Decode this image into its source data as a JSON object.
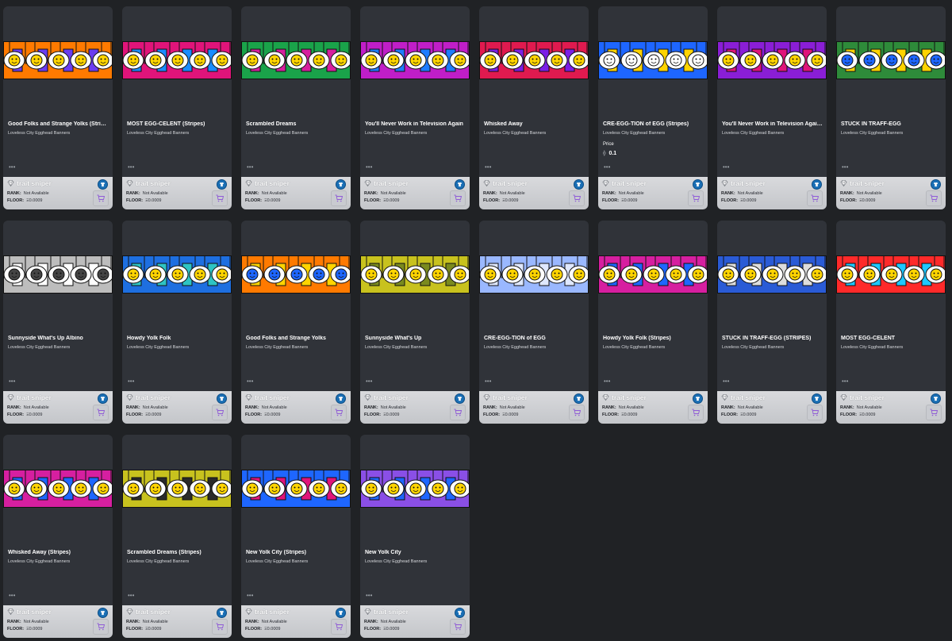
{
  "common": {
    "collection": "Loveless City Egghead Banners",
    "dots": "•••",
    "brand": "trait sniper",
    "rank_label": "RANK:",
    "rank_value": "Not Available",
    "floor_label": "FLOOR:",
    "floor_value": "Ξ0.0009",
    "price_label": "Price",
    "eth_symbol": "⟠"
  },
  "cards": [
    {
      "title": "Good Folks and Strange Yolks (Stripes)",
      "palette": [
        "#ff7a00",
        "#6a3df0",
        "#ffd400"
      ],
      "price": ""
    },
    {
      "title": "MOST EGG-CELENT (Stripes)",
      "palette": [
        "#e0147a",
        "#1a8cff",
        "#ffd400"
      ],
      "price": ""
    },
    {
      "title": "Scrambled Dreams",
      "palette": [
        "#1aa34a",
        "#d61f9e",
        "#ffd400"
      ],
      "price": ""
    },
    {
      "title": "You'll Never Work in Television Again",
      "palette": [
        "#c01ec8",
        "#1e7cff",
        "#ffd400"
      ],
      "price": ""
    },
    {
      "title": "Whisked Away",
      "palette": [
        "#e01a4f",
        "#7b1ee6",
        "#ffd400"
      ],
      "price": ""
    },
    {
      "title": "CRE-EGG-TION of EGG (Stripes)",
      "palette": [
        "#1e66ff",
        "#ffd400",
        "#ffffff"
      ],
      "price": "0.1"
    },
    {
      "title": "You'll Never Work in Television Again (...",
      "palette": [
        "#8a1ed6",
        "#e0147a",
        "#ffd400"
      ],
      "price": ""
    },
    {
      "title": "STUCK IN TRAFF-EGG",
      "palette": [
        "#2e8b3a",
        "#ffd400",
        "#1e66ff"
      ],
      "price": ""
    },
    {
      "title": "Sunnyside What's Up Albino",
      "palette": [
        "#bdbdbd",
        "#ffffff",
        "#444444"
      ],
      "price": ""
    },
    {
      "title": "Howdy Yolk Folk",
      "palette": [
        "#1e6fe0",
        "#2ec4c4",
        "#ffd400"
      ],
      "price": ""
    },
    {
      "title": "Good Folks and Strange Yolks",
      "palette": [
        "#ff7a00",
        "#ffd400",
        "#1e66ff"
      ],
      "price": ""
    },
    {
      "title": "Sunnyside What's Up",
      "palette": [
        "#c8c21e",
        "#7a8a1e",
        "#ffd400"
      ],
      "price": ""
    },
    {
      "title": "CRE-EGG-TION of EGG",
      "palette": [
        "#9ab8ff",
        "#dfe8ff",
        "#ffd400"
      ],
      "price": ""
    },
    {
      "title": "Howdy Yolk Folk (Stripes)",
      "palette": [
        "#d61fa0",
        "#1e66ff",
        "#ffd400"
      ],
      "price": ""
    },
    {
      "title": "STUCK IN TRAFF-EGG (STRIPES)",
      "palette": [
        "#2a5bd6",
        "#dddddd",
        "#ffd400"
      ],
      "price": ""
    },
    {
      "title": "MOST EGG-CELENT",
      "palette": [
        "#ff2a2a",
        "#1ec8ff",
        "#ffd400"
      ],
      "price": ""
    },
    {
      "title": "Whisked Away (Stripes)",
      "palette": [
        "#d61fa0",
        "#1e66ff",
        "#ffd400"
      ],
      "price": ""
    },
    {
      "title": "Scrambled Dreams (Stripes)",
      "palette": [
        "#c8c21e",
        "#2a2a2a",
        "#ffd400"
      ],
      "price": ""
    },
    {
      "title": "New Yolk City (Stripes)",
      "palette": [
        "#1e66ff",
        "#e0147a",
        "#ffd400"
      ],
      "price": ""
    },
    {
      "title": "New Yolk City",
      "palette": [
        "#8a4fe6",
        "#1e66ff",
        "#ffd400"
      ],
      "price": ""
    }
  ]
}
